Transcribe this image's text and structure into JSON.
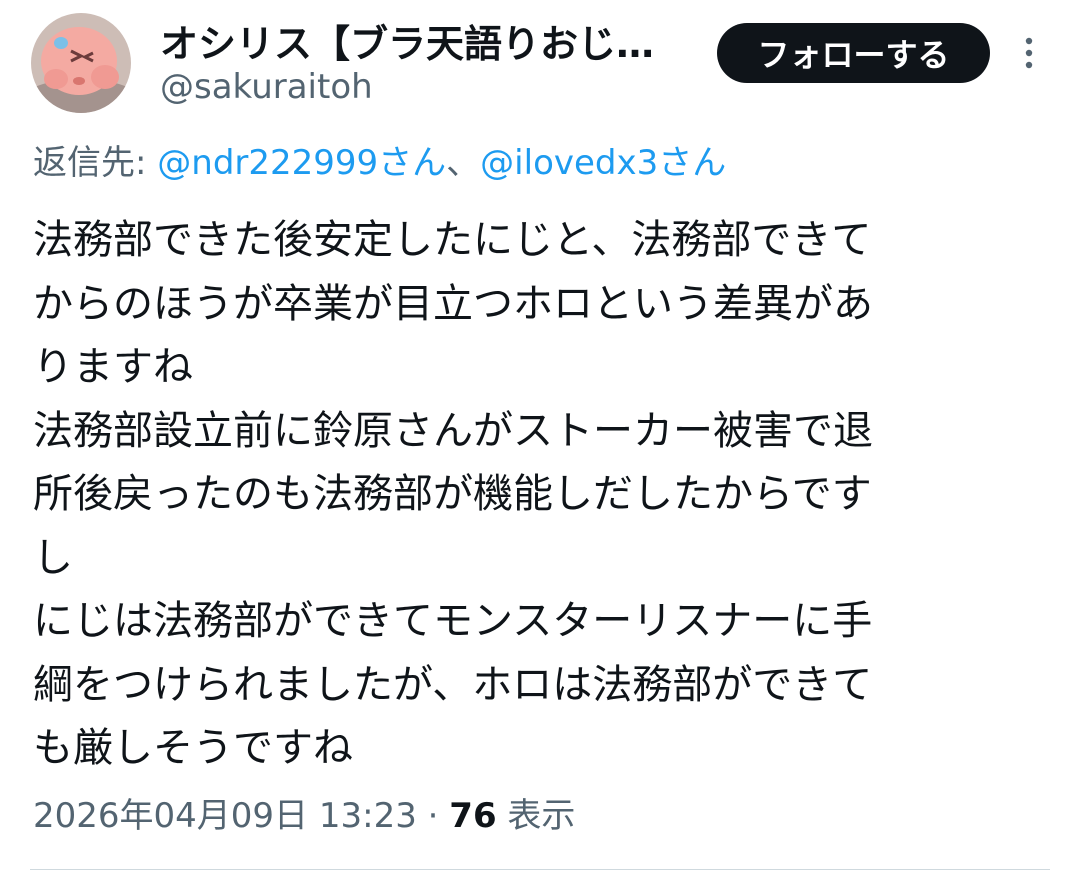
{
  "author": {
    "display_name": "オシリス【ブラ天語りおじ…",
    "handle": "@sakuraitoh",
    "avatar_icon": "avatar-icon"
  },
  "actions": {
    "follow_label": "フォローする",
    "more_icon": "more-vertical-icon"
  },
  "reply": {
    "prefix": "返信先: ",
    "mentions": [
      "@ndr222999さん",
      "@ilovedx3さん"
    ],
    "separator": "、"
  },
  "tweet": {
    "lines": [
      "法務部できた後安定したにじと、法務部できて",
      "からのほうが卒業が目立つホロという差異があ",
      "りますね",
      "法務部設立前に鈴原さんがストーカー被害で退",
      "所後戻ったのも法務部が機能しだしたからです",
      "し",
      "にじは法務部ができてモンスターリスナーに手",
      "綱をつけられましたが、ホロは法務部ができて",
      "も厳しそうですね"
    ]
  },
  "meta": {
    "timestamp": "2026年04月09日 13:23",
    "separator": " · ",
    "views_count": "76",
    "views_label": " 表示"
  },
  "colors": {
    "text": "#0f1419",
    "secondary": "#536471",
    "link": "#1d9bf0",
    "button_bg": "#0f1419",
    "avatar_bg": "#e8a8a0"
  }
}
